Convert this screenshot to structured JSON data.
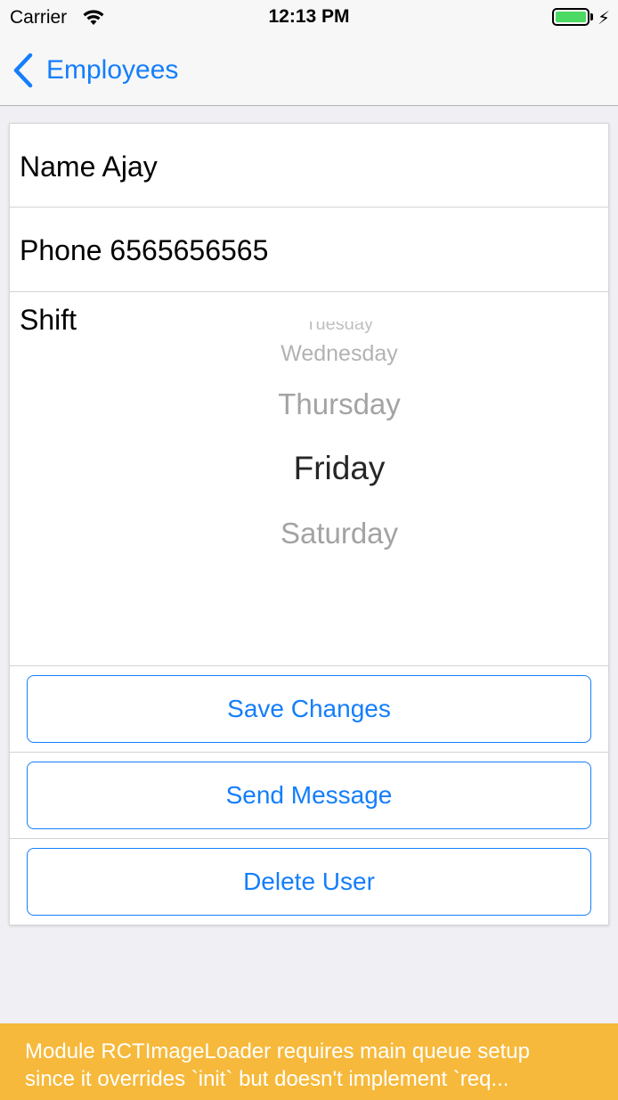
{
  "status_bar": {
    "carrier": "Carrier",
    "time": "12:13 PM",
    "battery_icon": "battery-icon",
    "battery_color": "#4cd964"
  },
  "nav": {
    "back_label": "Employees",
    "back_icon": "chevron-left-icon",
    "accent_color": "#147efb"
  },
  "form": {
    "name_row": "Name Ajay",
    "phone_row": "Phone 6565656565",
    "shift_label": "Shift",
    "shift_picker": {
      "options": [
        "Tuesday",
        "Wednesday",
        "Thursday",
        "Friday",
        "Saturday"
      ],
      "selected": "Friday"
    }
  },
  "buttons": {
    "save": "Save Changes",
    "send": "Send Message",
    "delete": "Delete User"
  },
  "warning": {
    "line1": "Module RCTImageLoader requires main queue setup",
    "line2": "since it overrides `init` but doesn't implement `req...",
    "color": "#f6b93b"
  }
}
